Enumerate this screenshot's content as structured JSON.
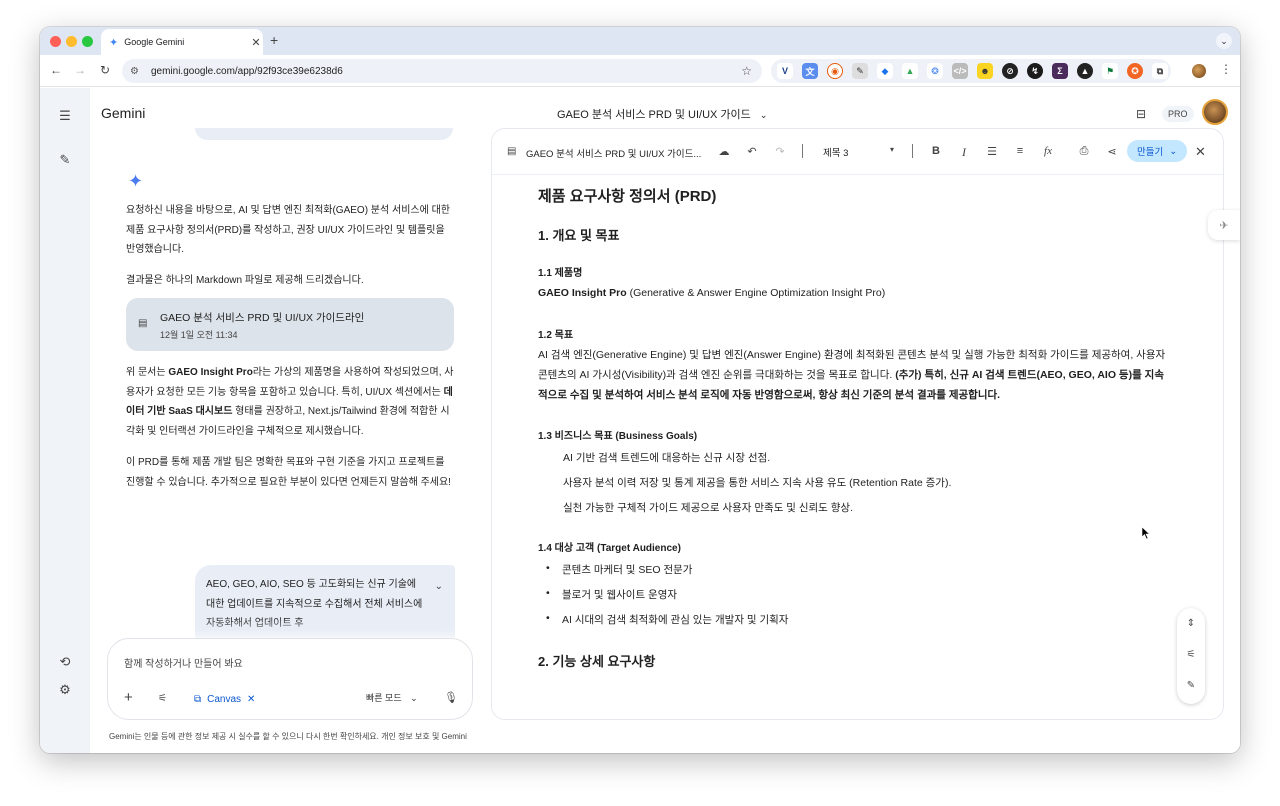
{
  "browser": {
    "tab_title": "Google Gemini",
    "url": "gemini.google.com/app/92f93ce39e6238d6"
  },
  "app": {
    "brand": "Gemini",
    "conversation_title": "GAEO 분석 서비스 PRD 및 UI/UX 가이드",
    "pro_label": "PRO"
  },
  "chat": {
    "response_intro": "요청하신 내용을 바탕으로, AI 및 답변 엔진 최적화(GAEO) 분석 서비스에 대한 제품 요구사항 정의서(PRD)를 작성하고, 권장 UI/UX 가이드라인 및 템플릿을 반영했습니다.",
    "response_result": "결과물은 하나의 Markdown 파일로 제공해 드리겠습니다.",
    "doc_card_title": "GAEO 분석 서비스 PRD 및 UI/UX 가이드라인",
    "doc_card_date": "12월 1일 오전 11:34",
    "response_detail_1": "위 문서는 ",
    "response_detail_bold_1": "GAEO Insight Pro",
    "response_detail_2": "라는 가상의 제품명을 사용하여 작성되었으며, 사용자가 요청한 모든 기능 항목을 포함하고 있습니다. 특히, UI/UX 섹션에서는 ",
    "response_detail_bold_2": "데이터 기반 SaaS 대시보드",
    "response_detail_3": " 형태를 권장하고, Next.js/Tailwind 환경에 적합한 시각화 및 인터랙션 가이드라인을 구체적으로 제시했습니다.",
    "response_outro": "이 PRD를 통해 제품 개발 팀은 명확한 목표와 구현 기준을 가지고 프로젝트를 진행할 수 있습니다. 추가적으로 필요한 부분이 있다면 언제든지 말씀해 주세요!",
    "user_message": "AEO, GEO, AIO, SEO 등 고도화되는 신규 기술에 대한 업데이트를 지속적으로 수집해서 전체 서비스에 자동화해서 업데이트 후",
    "composer_placeholder": "함께 작성하거나 만들어 봐요",
    "canvas_chip": "Canvas",
    "mode_label": "빠른 모드",
    "disclaimer": "Gemini는 인물 등에 관한 정보 제공 시 실수를 할 수 있으니 다시 한번 확인하세요. 개인 정보 보호 및 Gemini"
  },
  "canvas": {
    "title": "GAEO 분석 서비스 PRD 및 UI/UX 가이드...",
    "style_select": "제목 3",
    "make_button": "만들기",
    "doc": {
      "h1": "제품 요구사항 정의서 (PRD)",
      "s1": "1. 개요 및 목표",
      "s1_1": "1.1 제품명",
      "product_bold": "GAEO Insight Pro",
      "product_rest": " (Generative & Answer Engine Optimization Insight Pro)",
      "s1_2": "1.2 목표",
      "goal_text": "AI 검색 엔진(Generative Engine) 및 답변 엔진(Answer Engine) 환경에 최적화된 콘텐츠 분석 및 실행 가능한 최적화 가이드를 제공하여, 사용자 콘텐츠의 AI 가시성(Visibility)과 검색 엔진 순위를 극대화하는 것을 목표로 합니다. ",
      "goal_bold": "(추가) 특히, 신규 AI 검색 트렌드(AEO, GEO, AIO 등)를 지속적으로 수집 및 분석하여 서비스 분석 로직에 자동 반영함으로써, 항상 최신 기준의 분석 결과를 제공합니다.",
      "s1_3": "1.3 비즈니스 목표 (Business Goals)",
      "biz": [
        "AI 기반 검색 트렌드에 대응하는 신규 시장 선점.",
        "사용자 분석 이력 저장 및 통계 제공을 통한 서비스 지속 사용 유도 (Retention Rate 증가).",
        "실천 가능한 구체적 가이드 제공으로 사용자 만족도 및 신뢰도 향상."
      ],
      "s1_4": "1.4 대상 고객 (Target Audience)",
      "audience": [
        "콘텐츠 마케터 및 SEO 전문가",
        "블로거 및 웹사이트 운영자",
        "AI 시대의 검색 최적화에 관심 있는 개발자 및 기획자"
      ],
      "s2": "2. 기능 상세 요구사항"
    }
  },
  "colors": {
    "accent": "#0b57d0",
    "chip_bg": "#c2e7ff",
    "surface": "#f0f4f9",
    "gemini_spark": "#4a7bf0"
  }
}
